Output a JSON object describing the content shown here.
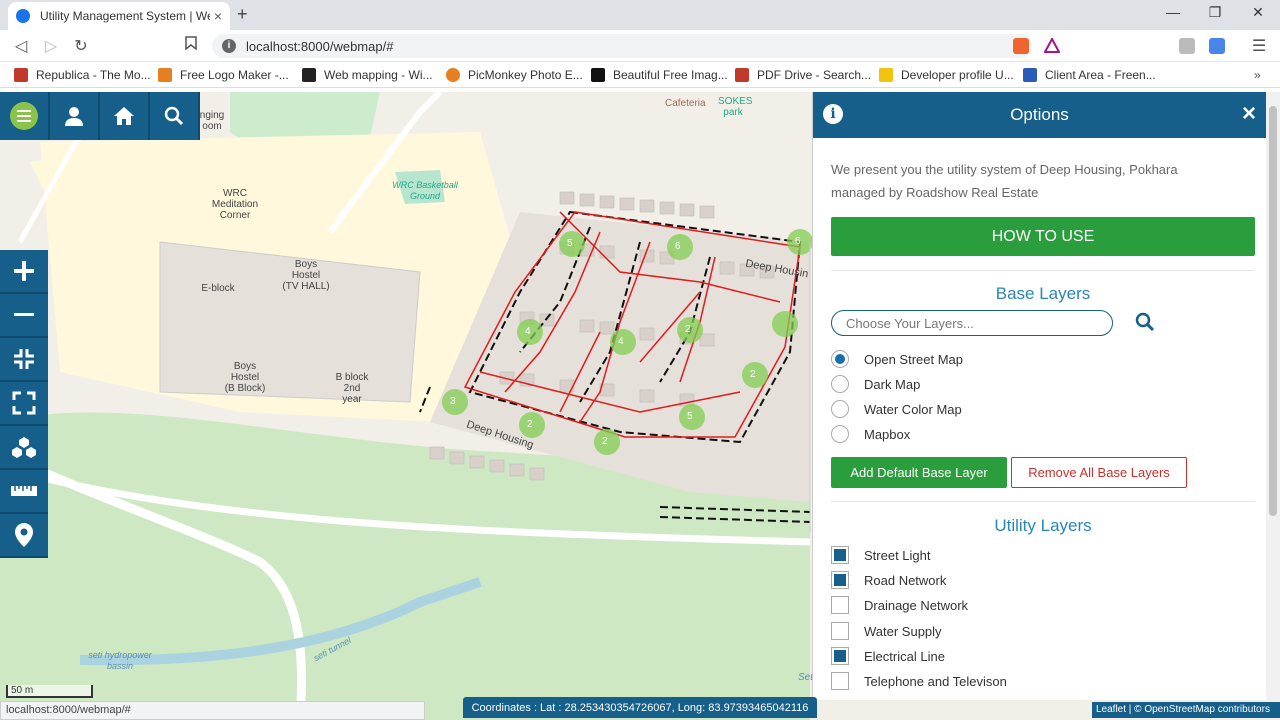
{
  "browser": {
    "tab_title": "Utility Management System | Web",
    "tab_close": "×",
    "new_tab": "+",
    "url": "localhost:8000/webmap/#",
    "bookmarks": [
      {
        "label": "Republica - The Mo...",
        "color": "#c0392b"
      },
      {
        "label": "Free Logo Maker -...",
        "color": "#e67e22"
      },
      {
        "label": "Web mapping - Wi...",
        "color": "#222222"
      },
      {
        "label": "PicMonkey Photo E...",
        "color": "#e67e22"
      },
      {
        "label": "Beautiful Free Imag...",
        "color": "#111111"
      },
      {
        "label": "PDF Drive - Search...",
        "color": "#c0392b"
      },
      {
        "label": "Developer profile U...",
        "color": "#f1c40f"
      },
      {
        "label": "Client Area - Freen...",
        "color": "#2a5bb8"
      }
    ]
  },
  "map": {
    "labels": {
      "cafeteria": "Cafeteria",
      "sokes_park": "SOKES park",
      "lounging_room": "nging\noom",
      "wrc_meditation": "WRC\nMeditation\nCorner",
      "wrc_basketball": "WRC Basketball\nGround",
      "boys_hostel_tv": "Boys\nHostel\n(TV HALL)",
      "e_block": "E-block",
      "boys_hostel_b": "Boys\nHostel\n(B Block)",
      "b_block_2nd": "B block\n2nd\nyear",
      "deep_housing_1": "Deep Housing",
      "deep_housing_2": "Deep Housin",
      "seti_hydropower": "seti hydropower\nbassin",
      "seti_tunnel": "seti tunnel",
      "seti": "Seti"
    },
    "clusters": [
      "5",
      "6",
      "4",
      "4",
      "2",
      "2",
      "3",
      "2",
      "2",
      "5",
      "6"
    ],
    "scale": "50 m",
    "status_url": "localhost:8000/webmap/#",
    "coordinates": "Coordinates : Lat : 28.253430354726067, Long: 83.97393465042116",
    "attribution": "Leaflet | © OpenStreetMap contributors"
  },
  "panel": {
    "title": "Options",
    "close": "×",
    "intro": "We present you the utility system of Deep Housing, Pokhara managed by Roadshow Real Estate",
    "how_to_use": "HOW TO USE",
    "base_layers_title": "Base Layers",
    "layer_search_placeholder": "Choose Your Layers...",
    "base_layers": [
      {
        "label": "Open Street Map",
        "selected": true
      },
      {
        "label": "Dark Map",
        "selected": false
      },
      {
        "label": "Water Color Map",
        "selected": false
      },
      {
        "label": "Mapbox",
        "selected": false
      }
    ],
    "add_default": "Add Default Base Layer",
    "remove_all": "Remove All Base Layers",
    "utility_layers_title": "Utility Layers",
    "utility_layers": [
      {
        "label": "Street Light",
        "checked": true
      },
      {
        "label": "Road Network",
        "checked": true
      },
      {
        "label": "Drainage Network",
        "checked": false
      },
      {
        "label": "Water Supply",
        "checked": false
      },
      {
        "label": "Electrical Line",
        "checked": true
      },
      {
        "label": "Telephone and Televison",
        "checked": false
      }
    ]
  },
  "colors": {
    "primary": "#155f8a",
    "green": "#2a9d3c",
    "danger": "#c9302c",
    "heading": "#2a86b8"
  }
}
